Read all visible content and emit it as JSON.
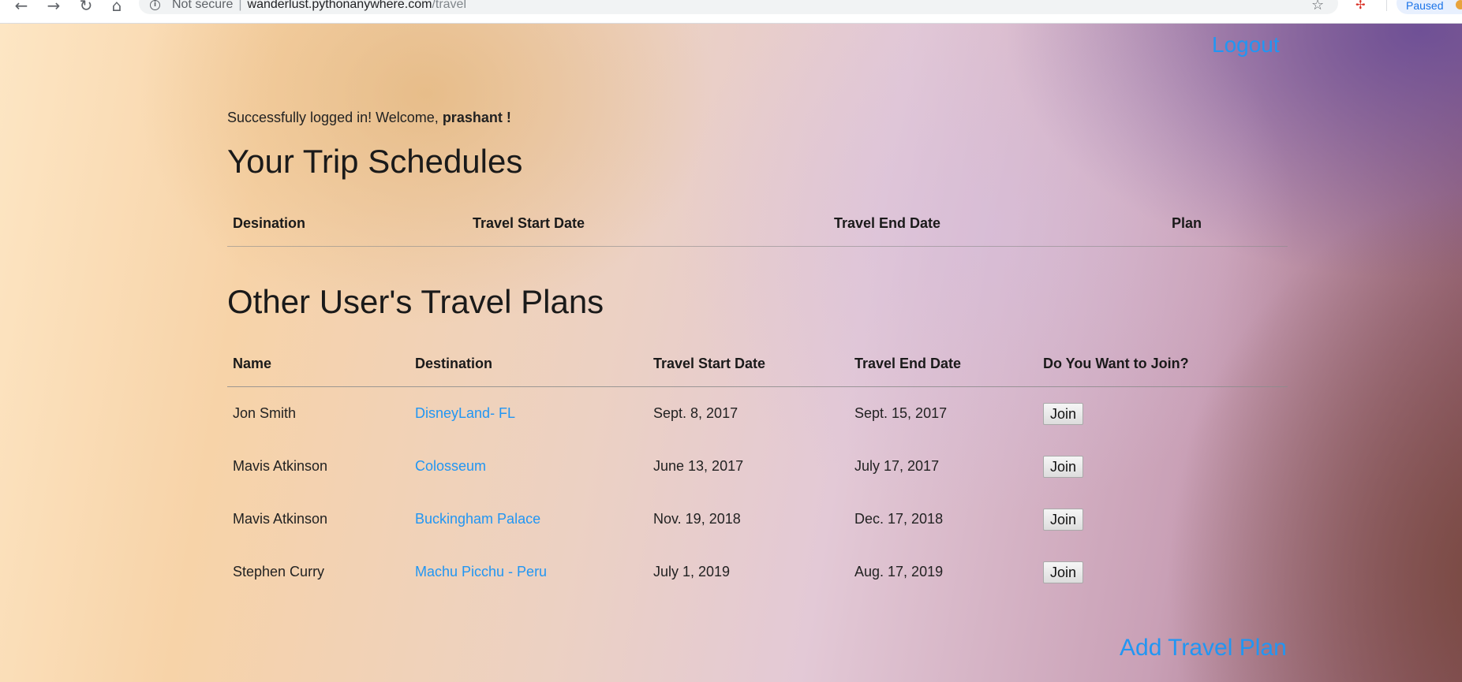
{
  "browser": {
    "security_label": "Not secure",
    "url_host": "wanderlust.pythonanywhere.com",
    "url_path": "/travel",
    "profile_status": "Paused"
  },
  "header": {
    "logout_label": "Logout"
  },
  "welcome": {
    "prefix": "Successfully logged in! Welcome,",
    "username": "prashant !"
  },
  "my_trips": {
    "title": "Your Trip Schedules",
    "columns": [
      "Desination",
      "Travel Start Date",
      "Travel End Date",
      "Plan"
    ]
  },
  "other_plans": {
    "title": "Other User's Travel Plans",
    "columns": [
      "Name",
      "Destination",
      "Travel Start Date",
      "Travel End Date",
      "Do You Want to Join?"
    ],
    "rows": [
      {
        "name": "Jon Smith",
        "destination": "DisneyLand- FL",
        "start": "Sept. 8, 2017",
        "end": "Sept. 15, 2017",
        "action": "Join"
      },
      {
        "name": "Mavis Atkinson",
        "destination": "Colosseum",
        "start": "June 13, 2017",
        "end": "July 17, 2017",
        "action": "Join"
      },
      {
        "name": "Mavis Atkinson",
        "destination": "Buckingham Palace",
        "start": "Nov. 19, 2018",
        "end": "Dec. 17, 2018",
        "action": "Join"
      },
      {
        "name": "Stephen Curry",
        "destination": "Machu Picchu - Peru",
        "start": "July 1, 2019",
        "end": "Aug. 17, 2019",
        "action": "Join"
      }
    ]
  },
  "footer": {
    "add_plan_label": "Add Travel Plan"
  },
  "colors": {
    "link": "#2196f3",
    "text": "#1a1a1a"
  },
  "icons": [
    "back-arrow-icon",
    "forward-arrow-icon",
    "reload-icon",
    "home-icon",
    "info-icon",
    "star-icon",
    "extension-icon"
  ]
}
